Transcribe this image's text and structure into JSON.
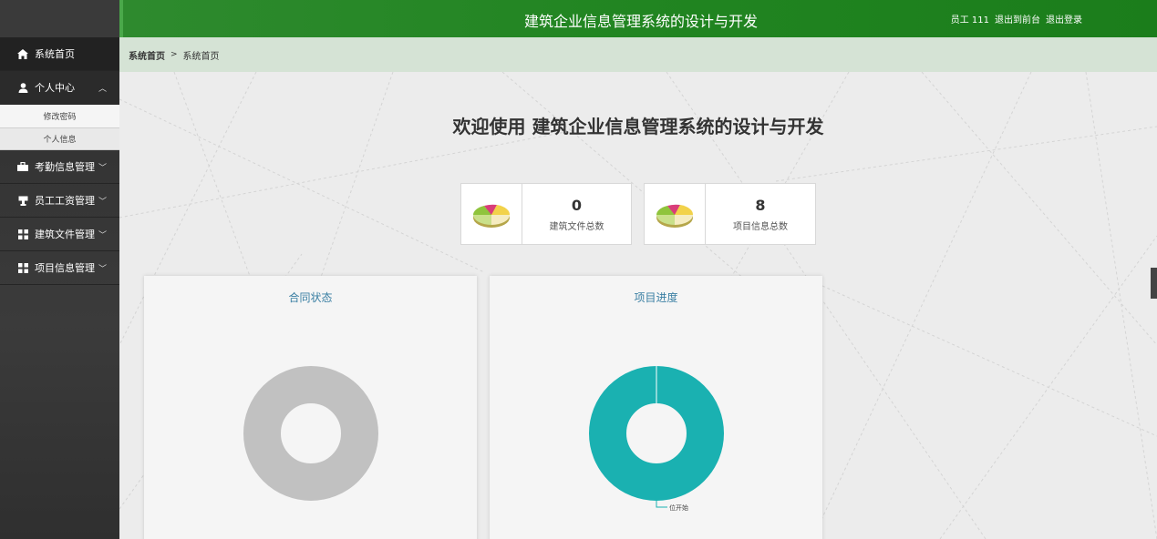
{
  "header": {
    "title": "建筑企业信息管理系统的设计与开发",
    "user": "员工 111",
    "to_front": "退出到前台",
    "logout": "退出登录"
  },
  "sidebar": {
    "home": "系统首页",
    "personal_center": "个人中心",
    "sub_items": [
      "修改密码",
      "个人信息"
    ],
    "items": [
      "考勤信息管理",
      "员工工资管理",
      "建筑文件管理",
      "项目信息管理"
    ]
  },
  "breadcrumb": {
    "root": "系统首页",
    "sep": ">",
    "current": "系统首页"
  },
  "main": {
    "welcome": "欢迎使用 建筑企业信息管理系统的设计与开发",
    "stats": [
      {
        "value": "0",
        "label": "建筑文件总数"
      },
      {
        "value": "8",
        "label": "项目信息总数"
      }
    ],
    "charts": [
      {
        "title": "合同状态"
      },
      {
        "title": "项目进度"
      }
    ]
  },
  "chart_data": [
    {
      "type": "pie",
      "title": "合同状态",
      "values": [],
      "labels": [],
      "colors": [
        "#c1c1c1"
      ]
    },
    {
      "type": "pie",
      "title": "项目进度",
      "labels": [
        "位开始"
      ],
      "values": [
        8
      ],
      "colors": [
        "#1ab1b1"
      ]
    }
  ]
}
